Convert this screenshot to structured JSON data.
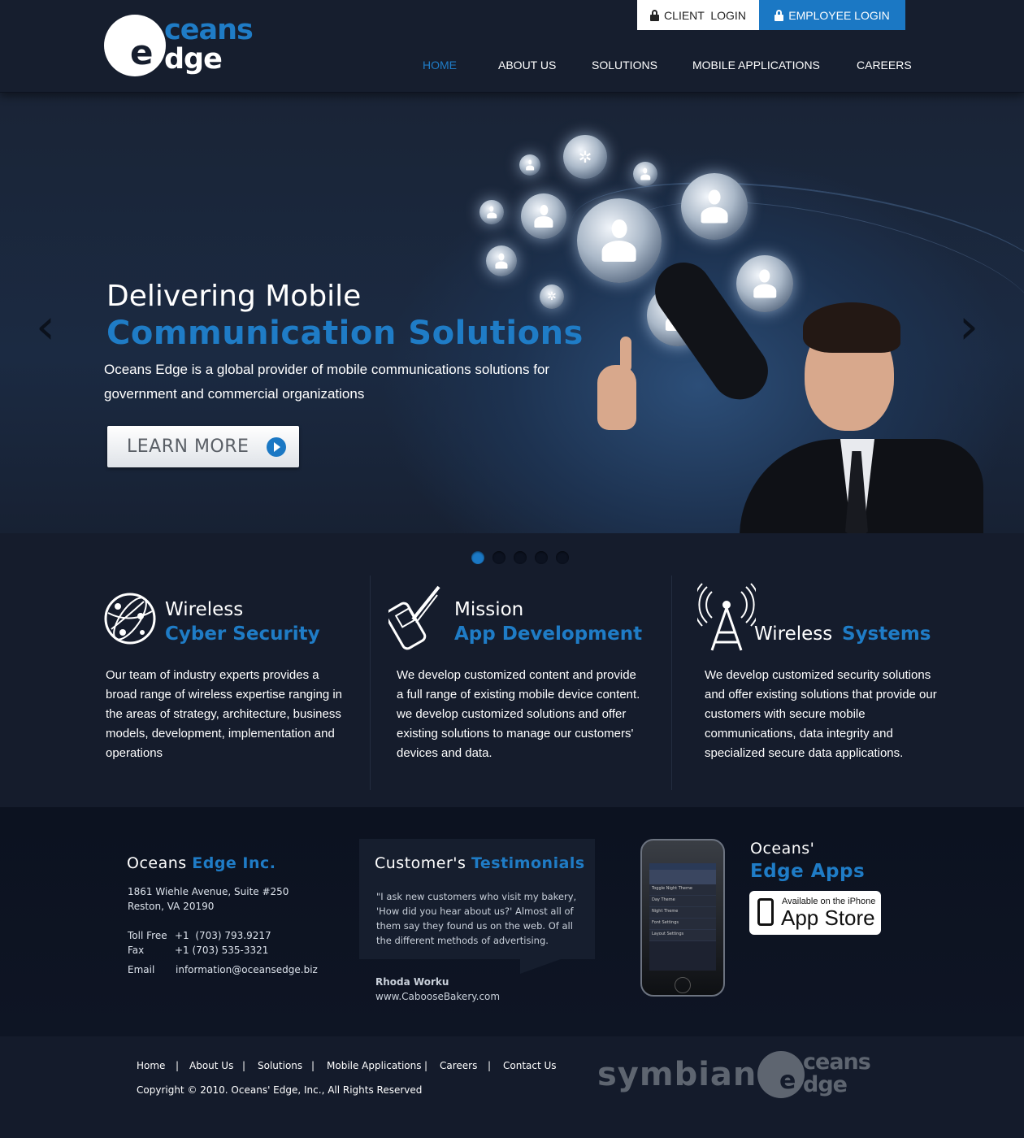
{
  "header": {
    "logo": {
      "mark_letter": "e",
      "top": "ceans",
      "bottom": "dge"
    },
    "client_login": "CLIENT  LOGIN",
    "employee_login": "EMPLOYEE LOGIN",
    "nav": [
      "HOME",
      "ABOUT US",
      "SOLUTIONS",
      "MOBILE APPLICATIONS",
      "CAREERS"
    ],
    "active_nav": "HOME"
  },
  "hero": {
    "title_line1": "Delivering Mobile",
    "title_line2": "Communication Solutions",
    "description": "Oceans Edge is a global provider of mobile communications solutions for government and commercial organizations",
    "cta_label": "LEARN MORE",
    "slides_total": 5,
    "slide_active": 1
  },
  "features": [
    {
      "icon": "globe-network-icon",
      "title1": "Wireless",
      "title2": "Cyber Security",
      "body": "Our team of industry experts provides a broad range of wireless expertise ranging in the areas of strategy, architecture, business models, development, implementation and operations"
    },
    {
      "icon": "phone-pen-icon",
      "title1": "Mission",
      "title2": "App Development",
      "body": "We develop customized content and provide a full range of existing mobile device content. we develop customized solutions and offer existing solutions to manage our customers' devices and data."
    },
    {
      "icon": "antenna-tower-icon",
      "title1": "Wireless",
      "title2": "Systems",
      "body": "We develop customized security solutions and offer existing solutions that provide our customers with secure mobile communications, data integrity and specialized secure data applications."
    }
  ],
  "company": {
    "heading_plain": "Oceans",
    "heading_blue": "Edge Inc.",
    "address1": "1861 Wiehle Avenue, Suite #250",
    "address2": "Reston, VA 20190",
    "tollfree_label": "Toll Free",
    "tollfree": "+1  (703) 793.9217",
    "fax_label": "Fax",
    "fax": "+1 (703) 535-3321",
    "email_label": "Email",
    "email": "information@oceansedge.biz"
  },
  "testimonial": {
    "heading_plain": "Customer's",
    "heading_blue": "Testimonials",
    "quote": "\"I ask new customers who visit my bakery, 'How did you hear about us?' Almost all of them say they found us on the web. Of all the different methods of advertising.",
    "author": "Rhoda Worku",
    "site": "www.CabooseBakery.com"
  },
  "apps": {
    "heading_plain": "Oceans'",
    "heading_blue": "Edge Apps",
    "phone_rows": [
      "Toggle Night Theme",
      "Day Theme",
      "Night Theme",
      "Font Settings",
      "Layout Settings"
    ],
    "badge_small": "Available on the iPhone",
    "badge_big": "App Store"
  },
  "footer": {
    "links": [
      "Home",
      "About Us",
      "Solutions",
      "Mobile Applications",
      "Careers",
      "Contact Us"
    ],
    "separator": "|",
    "copyright": "Copyright © 2010. Oceans' Edge, Inc., All Rights Reserved",
    "partner": "symbian",
    "logo_top": "ceans",
    "logo_bottom": "dge",
    "logo_mark": "e"
  },
  "colors": {
    "accent": "#1f7cc6",
    "background": "#141b2b"
  }
}
